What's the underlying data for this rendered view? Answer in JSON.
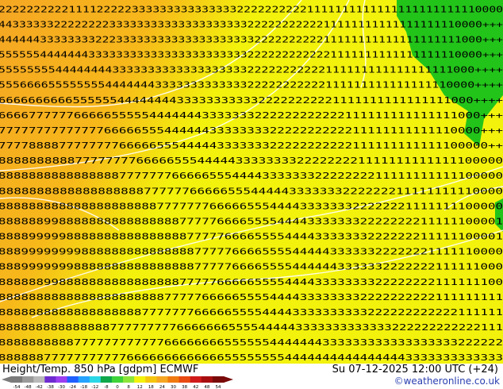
{
  "map": {
    "title": "Height/Temp. 850 hPa [gdpm] ECMWF",
    "valid_time": "Su 07-12-2025 12:00 UTC (+24)",
    "credit": "©weatheronline.co.uk",
    "colors": {
      "ocean_orange": "#f5a623",
      "land_yellow": "#f3f20c",
      "green": "#22c41a",
      "contour": "#ffffff",
      "digits": "#000000"
    },
    "colorbar": {
      "ticks": [
        "-54",
        "-48",
        "-42",
        "-38",
        "-30",
        "-24",
        "-18",
        "-12",
        "-8",
        "0",
        "8",
        "12",
        "18",
        "24",
        "30",
        "38",
        "42",
        "48",
        "54"
      ],
      "colors": [
        "#7b7b7b",
        "#9a9a9a",
        "#b9b9b9",
        "#6e2bd0",
        "#9b3ff0",
        "#1f5fff",
        "#25a3ff",
        "#2ad7e6",
        "#10a84a",
        "#3fd43a",
        "#8ce63a",
        "#f3f20c",
        "#f5c60f",
        "#f5a623",
        "#f07a10",
        "#e84a12",
        "#d01a1a",
        "#a80e10",
        "#7a0a0a"
      ]
    },
    "digit_rows": [
      "222222222211112222233333333333333322222222221111111111111111111111110000",
      "4433333322222222333333333333333333332222222222211111111111111111110000+++",
      "4444443333333322233333333333333333333222222222211111111111111111111000+++",
      "5555554444444333333333333333333333332222222222221111111111111111110000+++",
      "5555555544444444333333333333333333322222222222111111111111111111000++++",
      "5556666555555554444444333333333333322222222222111111111111111110000++++",
      "6666666666555555444444443333333333322222222221111111111111111000++++",
      "6666777777666665555544444443333333222222222222111111111111111000+++",
      "7777777777777766666555444444333333332222222222211111111111110000+++",
      "77778888777777776666655544444333333322222222222111111111111100000++",
      "888888888877777777666665554444433333333222222221111111111111100000",
      "8888888888888888777777766666555444433333332222222211111111111100000",
      "888888888888888888877777766666555444443333333222222211111111110000",
      "8888888888888888888887777777666665554444333333322222221111111100000",
      "8888889988888888888888887777766665555444433333332222222211111100001",
      "8888999998888888888888888777776666555544443333333222222211111100001",
      "8889999999988888888888888877777666655554444433333322222221111110000",
      "8889999999888888888888888877777666655554444443333332222222111111000",
      "8888889988888888888888887777766666555544443333333322222222111111100",
      "8888888888888888888888777776666655554444333333332222222222111111111",
      "8888888888888888888777777766666555544443333333333222222222222111111",
      "88888888888888877777777766666665555444443333333333333222222222222111",
      "8888888888777777777777666666665555554444444333333333333333333222222",
      "8888887777777777766666666666665555555544444444444444443333333333333"
    ]
  }
}
